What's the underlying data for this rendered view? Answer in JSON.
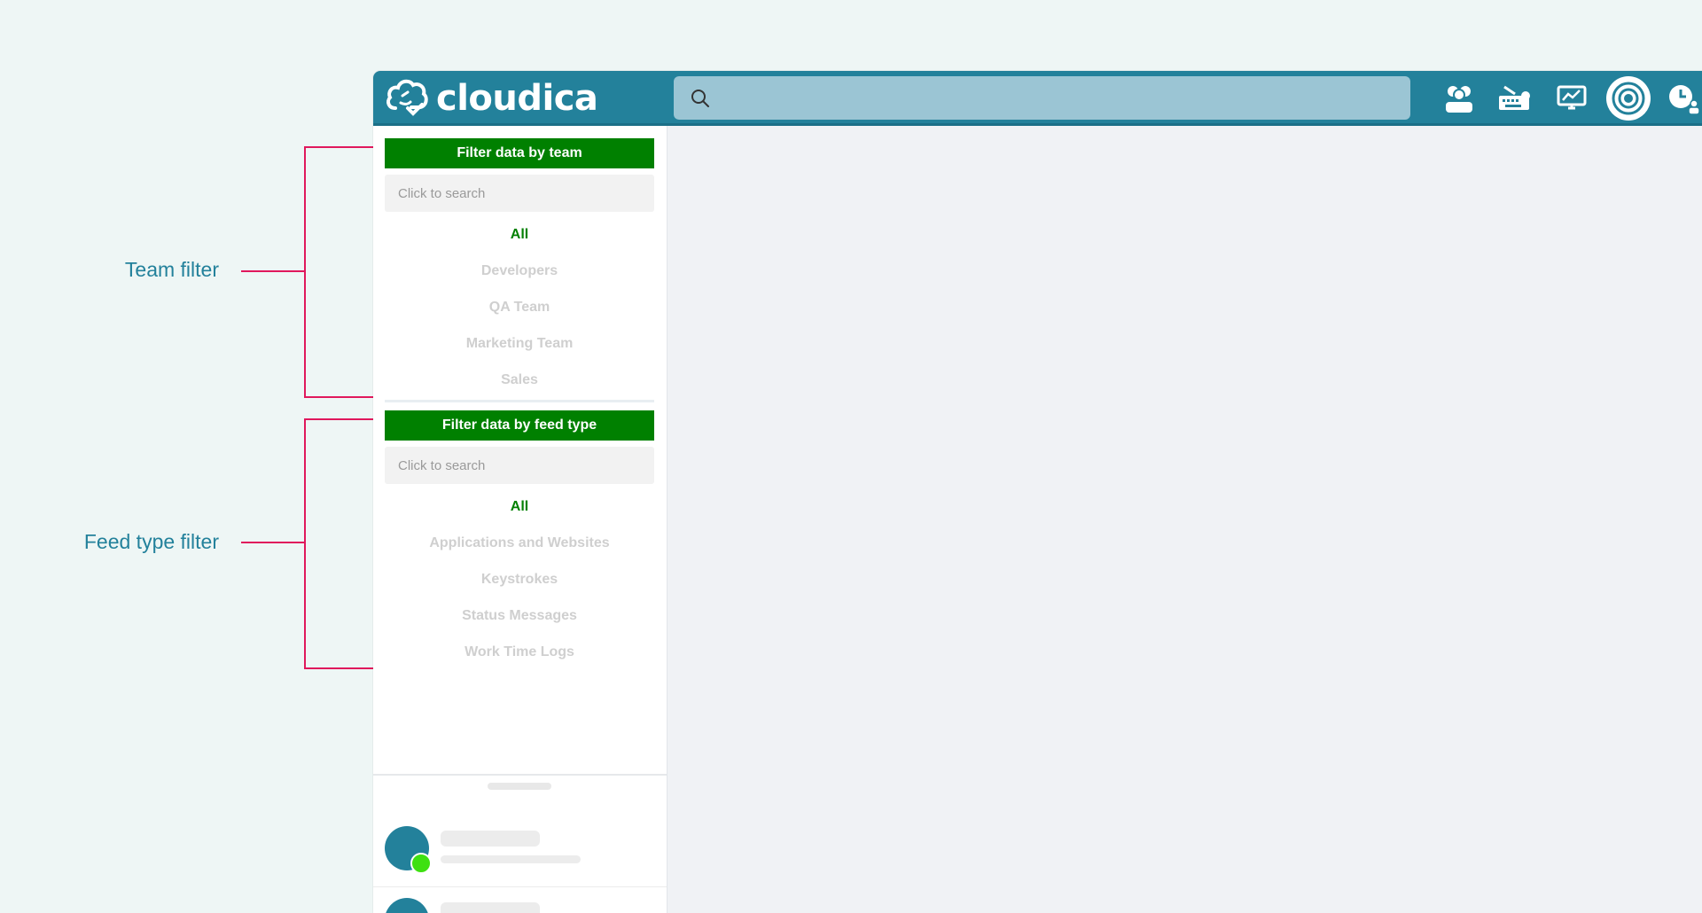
{
  "annotations": {
    "team_filter": "Team filter",
    "feed_type_filter": "Feed type filter",
    "bracket_color": "#e0185c"
  },
  "header": {
    "logo_text": "cloudica",
    "search_placeholder": "",
    "icons": [
      "team-icon",
      "keyboard-icon",
      "monitor-chart-icon",
      "live-broadcast-icon",
      "clock-user-icon"
    ],
    "brand_color": "#23819b"
  },
  "team_filter": {
    "title": "Filter data by team",
    "search_placeholder": "Click to search",
    "items": [
      {
        "label": "All",
        "active": true
      },
      {
        "label": "Developers",
        "active": false
      },
      {
        "label": "QA Team",
        "active": false
      },
      {
        "label": "Marketing Team",
        "active": false
      },
      {
        "label": "Sales",
        "active": false
      }
    ]
  },
  "feed_type_filter": {
    "title": "Filter data by feed type",
    "search_placeholder": "Click to search",
    "items": [
      {
        "label": "All",
        "active": true
      },
      {
        "label": "Applications and Websites",
        "active": false
      },
      {
        "label": "Keystrokes",
        "active": false
      },
      {
        "label": "Status Messages",
        "active": false
      },
      {
        "label": "Work Time Logs",
        "active": false
      }
    ]
  },
  "accent_color": "#008000"
}
